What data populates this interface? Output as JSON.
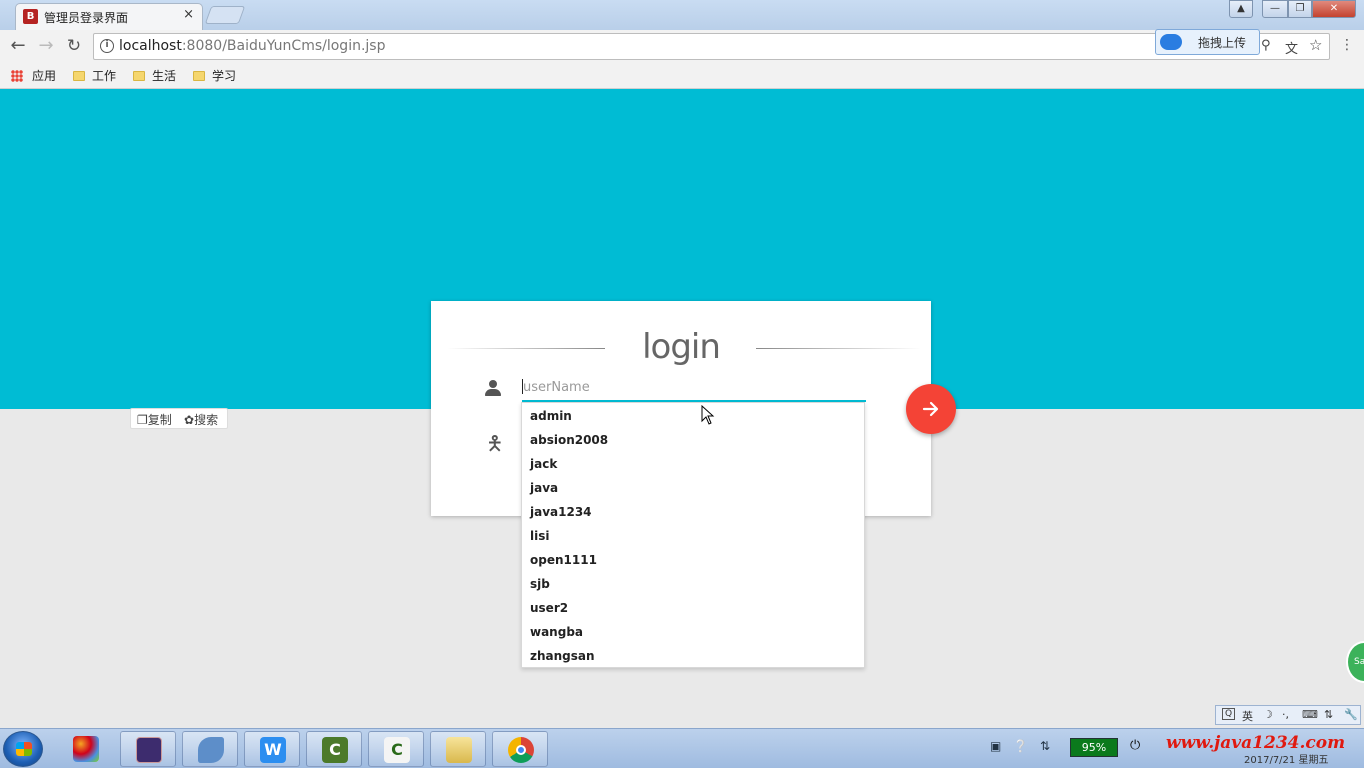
{
  "browser": {
    "tab_title": "管理员登录界面",
    "tab_favicon": "B",
    "tab_close": "×",
    "url_host": "localhost",
    "url_rest": ":8080/BaiduYunCms/login.jsp",
    "extension_label": "拖拽上传",
    "bookmarks": [
      {
        "label": "应用",
        "icon": "apps-icon"
      },
      {
        "label": "工作",
        "icon": "folder-icon"
      },
      {
        "label": "生活",
        "icon": "folder-icon"
      },
      {
        "label": "学习",
        "icon": "folder-icon"
      }
    ]
  },
  "page": {
    "hero_color": "#00bcd4",
    "accent_color": "#f44336",
    "copy_popup": {
      "copy": "复制",
      "search": "搜索"
    },
    "login": {
      "title": "login",
      "username_placeholder": "userName",
      "username_value": ""
    },
    "autocomplete": [
      "admin",
      "absion2008",
      "jack",
      "java",
      "java1234",
      "lisi",
      "open1111",
      "sjb",
      "user2",
      "wangba",
      "zhangsan"
    ]
  },
  "taskbar": {
    "ime_lang": "英",
    "battery": "95%",
    "watermark": "www.java1234.com",
    "date": "2017/7/21 星期五"
  }
}
